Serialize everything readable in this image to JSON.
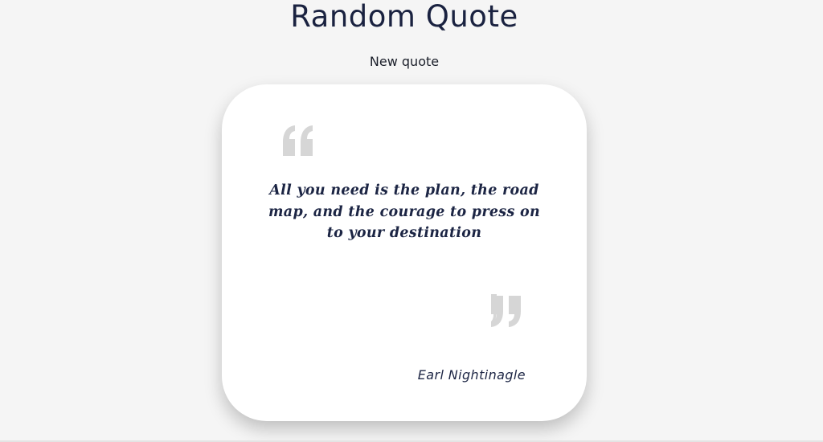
{
  "header": {
    "title": "Random Quote"
  },
  "controls": {
    "new_quote_label": "New quote"
  },
  "quote": {
    "text": "All you need is the plan, the road map, and the courage to press on to your destination",
    "author": "Earl Nightinagle",
    "open_icon": "open-quote-icon",
    "close_icon": "close-quote-icon"
  },
  "colors": {
    "background": "#f5f5f5",
    "card": "#ffffff",
    "text": "#1c2544",
    "quote_marks": "#d6d6d6"
  }
}
